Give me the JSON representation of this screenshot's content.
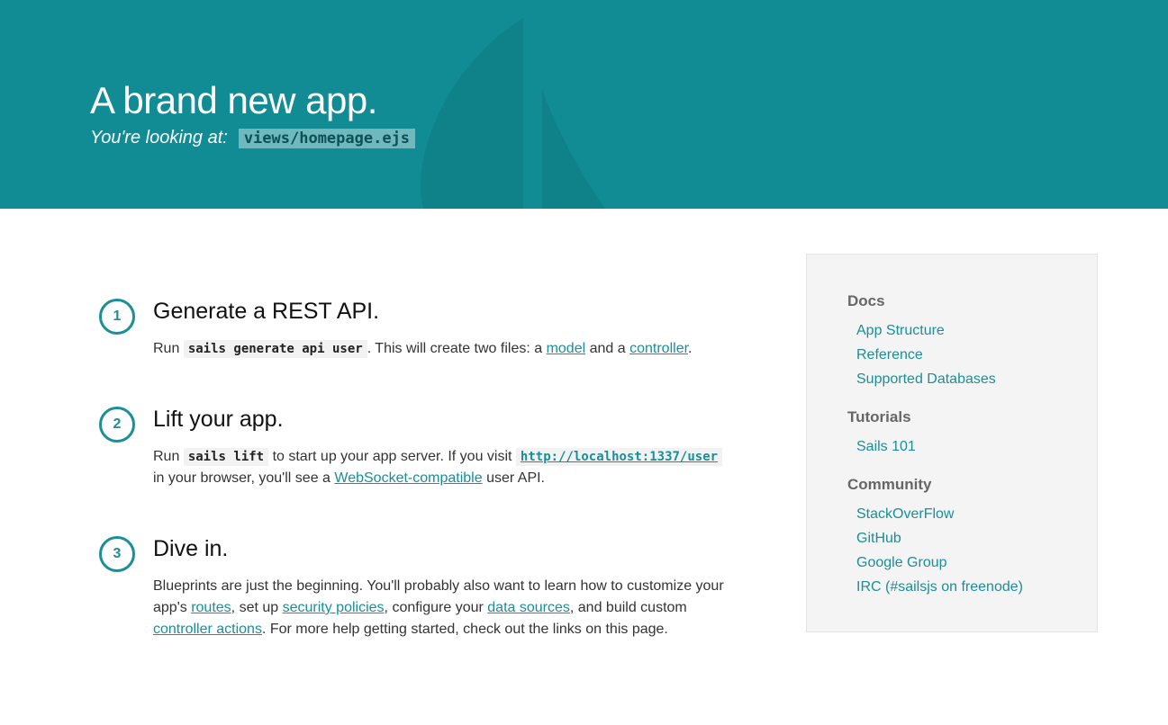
{
  "header": {
    "title": "A brand new app.",
    "subtitle_label": "You're looking at:",
    "subtitle_code": "views/homepage.ejs",
    "bg_color": "#118c95"
  },
  "steps": [
    {
      "number": "1",
      "title": "Generate a REST API.",
      "text_run": "Run",
      "code": "sails generate api user",
      "text_mid": ". This will create two files: a",
      "link_model": "model",
      "text_and": "and a",
      "link_controller": "controller",
      "text_end": "."
    },
    {
      "number": "2",
      "title": "Lift your app.",
      "text_run": "Run",
      "code": "sails lift",
      "text_mid": "to start up your app server. If you visit",
      "url": "http://localhost:1337/user",
      "text_browser": "in your browser, you'll see a",
      "link_ws": "WebSocket-compatible",
      "text_end": "user API."
    },
    {
      "number": "3",
      "title": "Dive in.",
      "text_a": "Blueprints are just the beginning. You'll probably also want to learn how to customize your app's",
      "link_routes": "routes",
      "text_b": ", set up",
      "link_security": "security policies",
      "text_c": ", configure your",
      "link_data": "data sources",
      "text_d": ", and build custom",
      "link_actions": "controller actions",
      "text_e": ". For more help getting started, check out the links on this page."
    }
  ],
  "sidebar": {
    "docs_heading": "Docs",
    "docs": [
      "App Structure",
      "Reference",
      "Supported Databases"
    ],
    "tutorials_heading": "Tutorials",
    "tutorials": [
      "Sails 101"
    ],
    "community_heading": "Community",
    "community": [
      "StackOverFlow",
      "GitHub",
      "Google Group",
      "IRC (#sailsjs on freenode)"
    ]
  },
  "colors": {
    "accent": "#1a8f98",
    "sidebar_bg": "#f4f4f4"
  }
}
